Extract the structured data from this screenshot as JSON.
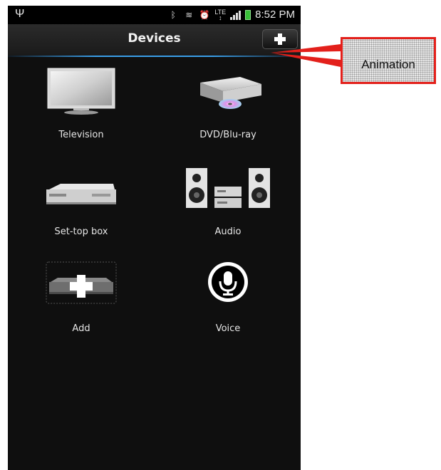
{
  "status_bar": {
    "time": "8:52 PM",
    "network": "LTE",
    "icons": [
      "usb-icon",
      "bluetooth-icon",
      "nfc-icon",
      "alarm-icon",
      "lte-icon",
      "signal-icon",
      "battery-icon"
    ]
  },
  "action_bar": {
    "title": "Devices",
    "add_button_icon": "plus-icon"
  },
  "devices": [
    {
      "label": "Television",
      "icon": "television-icon"
    },
    {
      "label": "DVD/Blu-ray",
      "icon": "dvd-player-icon"
    },
    {
      "label": "Set-top box",
      "icon": "set-top-box-icon"
    },
    {
      "label": "Audio",
      "icon": "audio-system-icon"
    },
    {
      "label": "Add",
      "icon": "add-device-icon"
    },
    {
      "label": "Voice",
      "icon": "microphone-icon"
    }
  ],
  "annotation": {
    "label": "Animation",
    "border_color": "#e3201b"
  },
  "colors": {
    "background": "#0f0f0f",
    "accent_line": "#3a9ee8"
  }
}
